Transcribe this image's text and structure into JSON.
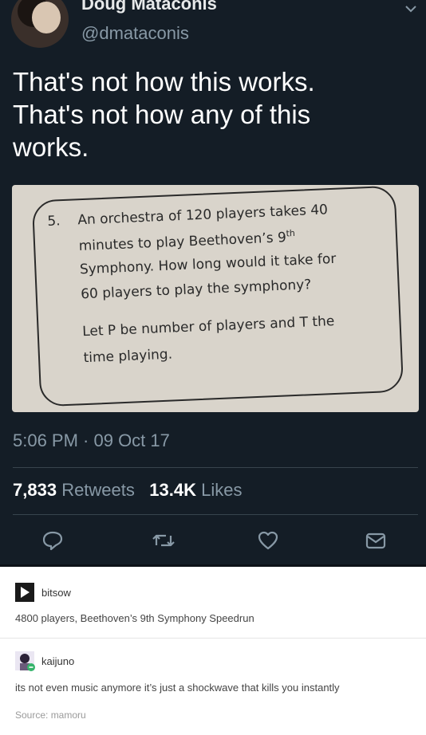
{
  "tweet": {
    "display_name": "Doug Mataconis",
    "handle": "@dmataconis",
    "text_lines": [
      "That's not how this works.",
      "That's not how any of this",
      "works."
    ],
    "photo": {
      "number": "5.",
      "line1": "An orchestra of 120 players takes 40",
      "line2_pre": "minutes to play Beethoven’s 9",
      "line2_sup": "th",
      "line3": "Symphony. How long would it take for",
      "line4": "60 players to play the symphony?",
      "line5": "Let P be number of players and T the",
      "line6": "time playing."
    },
    "timestamp": "5:06 PM · 09 Oct 17",
    "retweets_count": "7,833",
    "retweets_label": "Retweets",
    "likes_count": "13.4K",
    "likes_label": "Likes",
    "actions": [
      "reply-icon",
      "retweet-icon",
      "like-icon",
      "message-icon"
    ],
    "colors": {
      "background": "#141d26",
      "muted": "#8899a6",
      "divider": "#38444d"
    }
  },
  "replies": [
    {
      "user": "bitsow",
      "text": "4800 players, Beethoven’s 9th Symphony Speedrun"
    },
    {
      "user": "kaijuno",
      "text": "its not even music anymore it’s just a shockwave that kills you instantly"
    }
  ],
  "source": "Source: mamoru"
}
